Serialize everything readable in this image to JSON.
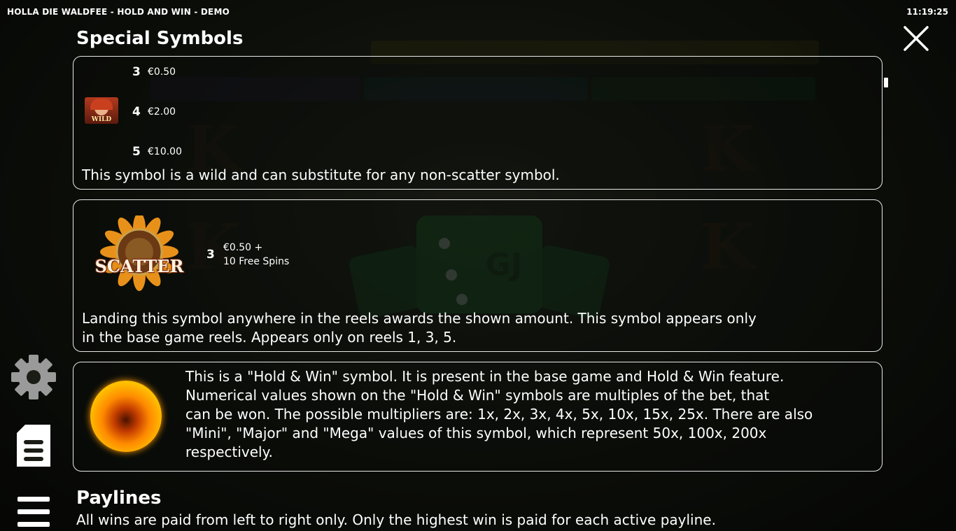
{
  "header": {
    "game_title": "HOLLA DIE WALDFEE - HOLD AND WIN - DEMO",
    "clock": "11:19:25"
  },
  "sections": {
    "special_symbols_title": "Special Symbols",
    "paylines_title": "Paylines",
    "paylines_text": "All wins are paid from left to right only. Only the highest win is paid for each active payline."
  },
  "wild_card": {
    "symbol_label": "WILD",
    "payouts": [
      {
        "count": "3",
        "value": "€0.50"
      },
      {
        "count": "4",
        "value": "€2.00"
      },
      {
        "count": "5",
        "value": "€10.00"
      }
    ],
    "description": "This symbol is a wild and can substitute for any non-scatter symbol."
  },
  "scatter_card": {
    "symbol_label": "SCATTER",
    "payout_count": "3",
    "payout_value": "€0.50 +",
    "payout_extra": "10 Free Spins",
    "description_line1": "Landing this symbol anywhere in the reels awards the shown amount. This symbol appears only",
    "description_line2": "in the base game reels. Appears only on reels 1, 3, 5."
  },
  "holdwin_card": {
    "lines": [
      "This is a \"Hold & Win\" symbol. It is present in the base game and Hold & Win feature.",
      "Numerical values shown on the \"Hold & Win\" symbols are multiples of the bet, that",
      "can be won. The possible multipliers are: 1x, 2x, 3x, 4x, 5x, 10x, 15x, 25x. There are also",
      "\"Mini\", \"Major\" and \"Mega\" values of this symbol, which represent 50x, 100x, 200x",
      "respectively."
    ]
  },
  "sidebar": {
    "settings_icon": "gear-icon",
    "info_icon": "document-icon",
    "menu_icon": "hamburger-icon"
  },
  "colors": {
    "text": "#ffffff",
    "card_border": "#e8e8e8",
    "coin_gold": "#f5b400"
  }
}
